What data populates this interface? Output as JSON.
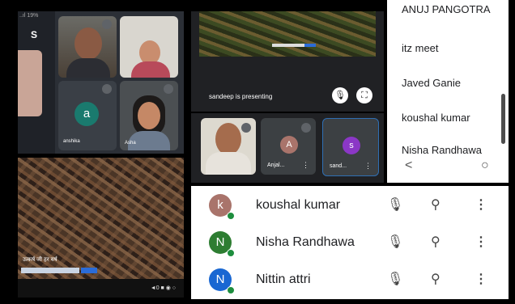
{
  "top_left": {
    "status_text": "..ıl 19%",
    "app_glyph": "S",
    "tile_a": {
      "initial": "a",
      "name": "anshika"
    },
    "tile_b": {
      "name": "Asha"
    }
  },
  "bottom_left": {
    "caption": "उत्कर्ष जी हर वर्ष",
    "controls": "◄0 ■ ◉ ○"
  },
  "presentation": {
    "presenter_text": "sandeep is presenting",
    "mic_glyph": "🎙",
    "fullscreen_glyph": "⛶"
  },
  "strip": [
    {
      "label": "",
      "initial": ""
    },
    {
      "label": "Anjal...",
      "initial": "A"
    },
    {
      "label": "sand...",
      "initial": "s"
    }
  ],
  "right_list": {
    "names": [
      "ANUJ PANGOTRA",
      "itz meet",
      "Javed Ganie",
      "koushal kumar",
      "Nisha Randhawa"
    ],
    "back_glyph": "<",
    "home_glyph": "○"
  },
  "participants": [
    {
      "initial": "k",
      "name": "koushal kumar",
      "color": "#a9746b"
    },
    {
      "initial": "N",
      "name": "Nisha Randhawa",
      "color": "#2e7d32"
    },
    {
      "initial": "N",
      "name": "Nittin attri",
      "color": "#1967d2"
    }
  ],
  "icons": {
    "mute": "🎙",
    "pin": "⚲",
    "more": "⋮"
  }
}
